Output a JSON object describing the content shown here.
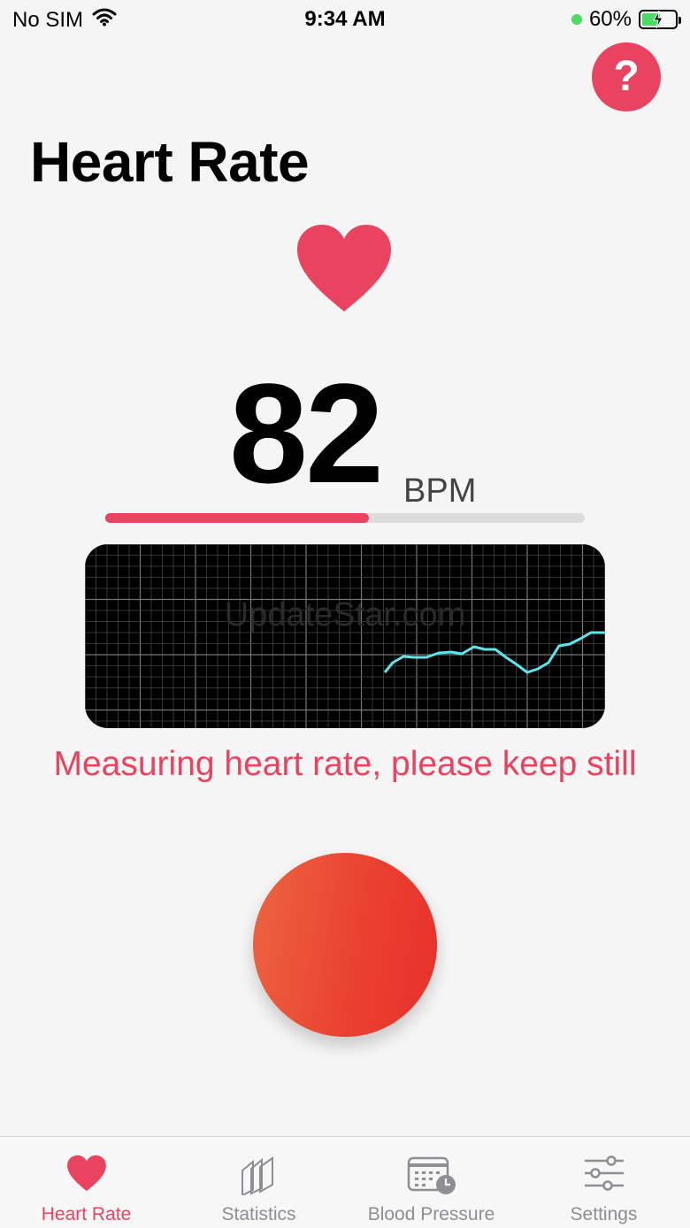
{
  "status_bar": {
    "carrier": "No SIM",
    "time": "9:34 AM",
    "battery_percent": "60%",
    "battery_level": 0.6,
    "icons": [
      "wifi-icon",
      "location-dot-icon",
      "battery-charging-icon"
    ]
  },
  "header": {
    "help_label": "?",
    "title": "Heart Rate"
  },
  "reading": {
    "value": "82",
    "unit": "BPM",
    "progress": 0.55
  },
  "graph": {
    "watermark": "UpdateStar.com",
    "line_color": "#5ce6ef"
  },
  "status": {
    "message": "Measuring heart rate, please keep still"
  },
  "tabs": [
    {
      "label": "Heart Rate",
      "icon": "heart-icon",
      "active": true
    },
    {
      "label": "Statistics",
      "icon": "statistics-icon",
      "active": false
    },
    {
      "label": "Blood Pressure",
      "icon": "calendar-clock-icon",
      "active": false
    },
    {
      "label": "Settings",
      "icon": "sliders-icon",
      "active": false
    }
  ],
  "colors": {
    "accent": "#e9435f",
    "button_gradient_start": "#ec6541",
    "button_gradient_end": "#e8302a",
    "inactive_tab": "#8e8e93"
  }
}
